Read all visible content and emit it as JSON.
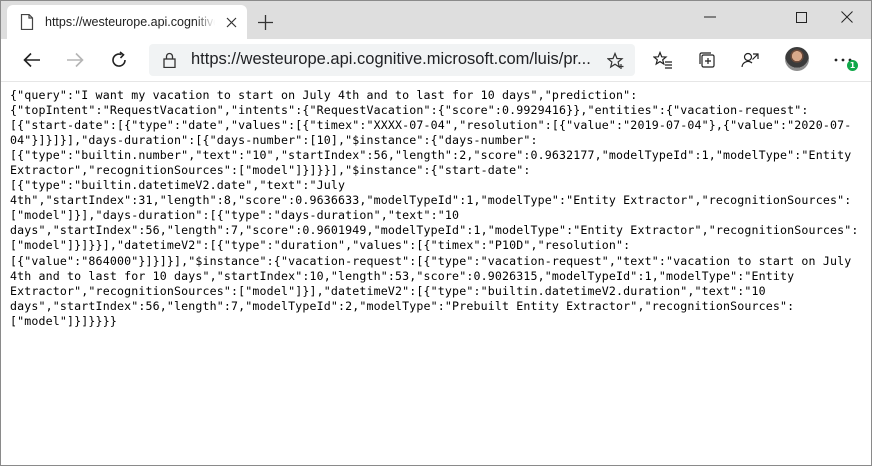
{
  "browser": {
    "tab_title": "https://westeurope.api.cognitive.microsoft.com/luis/prediction",
    "url": "https://westeurope.api.cognitive.microsoft.com/luis/pr...",
    "extensions_badge": "1"
  },
  "page": {
    "json_lines": [
      "{\"query\":\"I want my vacation to start on July 4th and to last for 10 days\",\"prediction\":",
      "{\"topIntent\":\"RequestVacation\",\"intents\":{\"RequestVacation\":{\"score\":0.9929416}},\"entities\":{\"vacation-request\":",
      "[{\"start-date\":[{\"type\":\"date\",\"values\":[{\"timex\":\"XXXX-07-04\",\"resolution\":[{\"value\":\"2019-07-04\"},{\"value\":\"2020-07-",
      "04\"}]}]}],\"days-duration\":[{\"days-number\":[10],\"$instance\":{\"days-number\":",
      "[{\"type\":\"builtin.number\",\"text\":\"10\",\"startIndex\":56,\"length\":2,\"score\":0.9632177,\"modelTypeId\":1,\"modelType\":\"Entity",
      "Extractor\",\"recognitionSources\":[\"model\"]}]}}],\"$instance\":{\"start-date\":",
      "[{\"type\":\"builtin.datetimeV2.date\",\"text\":\"July",
      "4th\",\"startIndex\":31,\"length\":8,\"score\":0.9636633,\"modelTypeId\":1,\"modelType\":\"Entity Extractor\",\"recognitionSources\":",
      "[\"model\"]}],\"days-duration\":[{\"type\":\"days-duration\",\"text\":\"10",
      "days\",\"startIndex\":56,\"length\":7,\"score\":0.9601949,\"modelTypeId\":1,\"modelType\":\"Entity Extractor\",\"recognitionSources\":",
      "[\"model\"]}]}}],\"datetimeV2\":[{\"type\":\"duration\",\"values\":[{\"timex\":\"P10D\",\"resolution\":",
      "[{\"value\":\"864000\"}]}]}],\"$instance\":{\"vacation-request\":[{\"type\":\"vacation-request\",\"text\":\"vacation to start on July",
      "4th and to last for 10 days\",\"startIndex\":10,\"length\":53,\"score\":0.9026315,\"modelTypeId\":1,\"modelType\":\"Entity",
      "Extractor\",\"recognitionSources\":[\"model\"]}],\"datetimeV2\":[{\"type\":\"builtin.datetimeV2.duration\",\"text\":\"10",
      "days\",\"startIndex\":56,\"length\":7,\"modelTypeId\":2,\"modelType\":\"Prebuilt Entity Extractor\",\"recognitionSources\":",
      "[\"model\"]}]}}}}"
    ]
  }
}
